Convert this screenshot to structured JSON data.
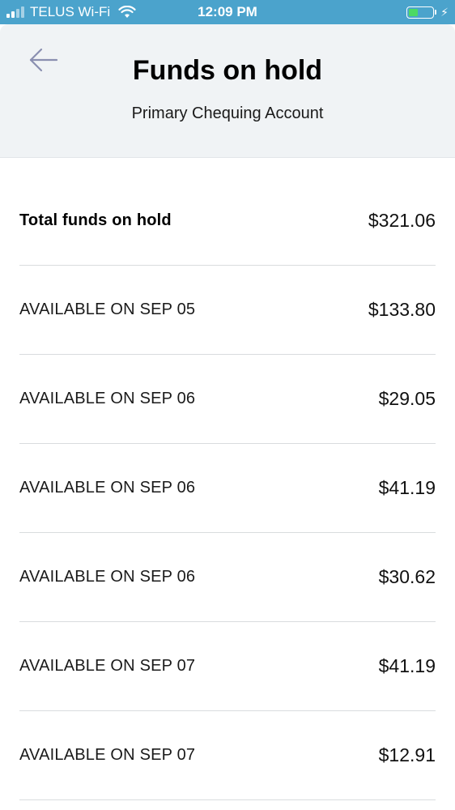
{
  "status_bar": {
    "carrier": "TELUS Wi-Fi",
    "time": "12:09 PM",
    "background_color": "#4ba3cc",
    "battery_color": "#4cd964"
  },
  "header": {
    "back_icon": "arrow-left-icon",
    "title": "Funds on hold",
    "subtitle": "Primary Chequing Account"
  },
  "total": {
    "label": "Total funds on hold",
    "amount": "$321.06"
  },
  "holds": [
    {
      "label": "AVAILABLE ON SEP 05",
      "amount": "$133.80"
    },
    {
      "label": "AVAILABLE ON SEP 06",
      "amount": "$29.05"
    },
    {
      "label": "AVAILABLE ON SEP 06",
      "amount": "$41.19"
    },
    {
      "label": "AVAILABLE ON SEP 06",
      "amount": "$30.62"
    },
    {
      "label": "AVAILABLE ON SEP 07",
      "amount": "$41.19"
    },
    {
      "label": "AVAILABLE ON SEP 07",
      "amount": "$12.91"
    }
  ]
}
